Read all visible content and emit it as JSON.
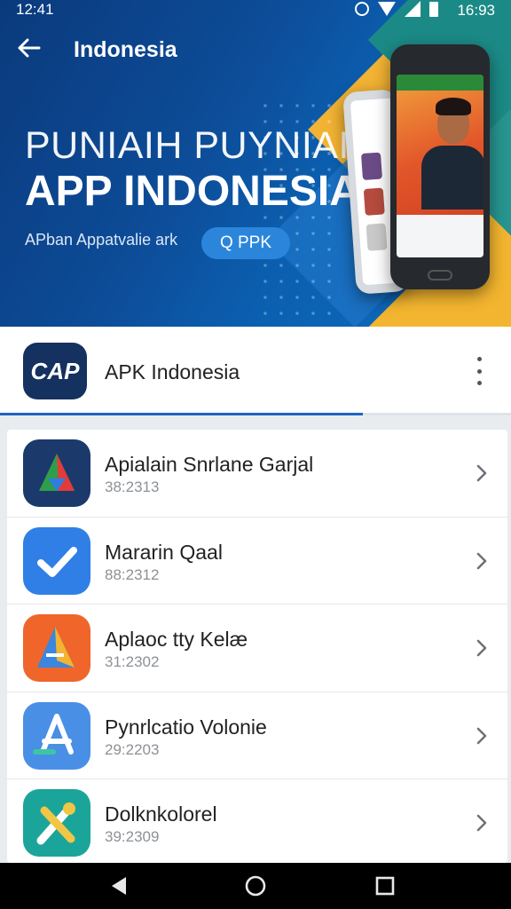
{
  "status_bar": {
    "time_left": "12:41",
    "time_right": "16:93"
  },
  "app_bar": {
    "title": "Indonesia",
    "back_icon": "arrow-left-icon"
  },
  "hero": {
    "title_line_1": "PUNIAIH PUYNIAI <",
    "title_line_2": "APP INDONESIA",
    "subtitle": "APban Appatvalie ark",
    "pill_label": "Q PPK"
  },
  "app_header": {
    "logo_text": "CAP",
    "name": "APK Indonesia",
    "menu_icon": "more-vertical-icon",
    "progress": 0.71
  },
  "list": [
    {
      "title": "Apialain Snrlane Garjal",
      "subtitle": "38:2313",
      "icon": "triangle-a-icon",
      "icon_colors": [
        "#1b3a6b",
        "#e23b3b",
        "#2f9e4a",
        "#2f7de1"
      ]
    },
    {
      "title": "Mararin Qaal",
      "subtitle": "88:2312",
      "icon": "checkmark-icon",
      "icon_colors": [
        "#2f7fe6"
      ]
    },
    {
      "title": "Aplaoc tty Kelæ",
      "subtitle": "31:2302",
      "icon": "paper-plane-a-icon",
      "icon_colors": [
        "#f0662a",
        "#3a86e0",
        "#f3b433"
      ]
    },
    {
      "title": "Pynrlcatio Volonie",
      "subtitle": "29:2203",
      "icon": "app-store-a-icon",
      "icon_colors": [
        "#4a8fe6",
        "#3cc7a1"
      ]
    },
    {
      "title": "Dolknkolorel",
      "subtitle": "39:2309",
      "icon": "tools-icon",
      "icon_colors": [
        "#1ba59a",
        "#f1c644"
      ]
    }
  ],
  "navbar": {
    "back": "nav-back-icon",
    "home": "nav-home-icon",
    "recent": "nav-recent-icon"
  }
}
